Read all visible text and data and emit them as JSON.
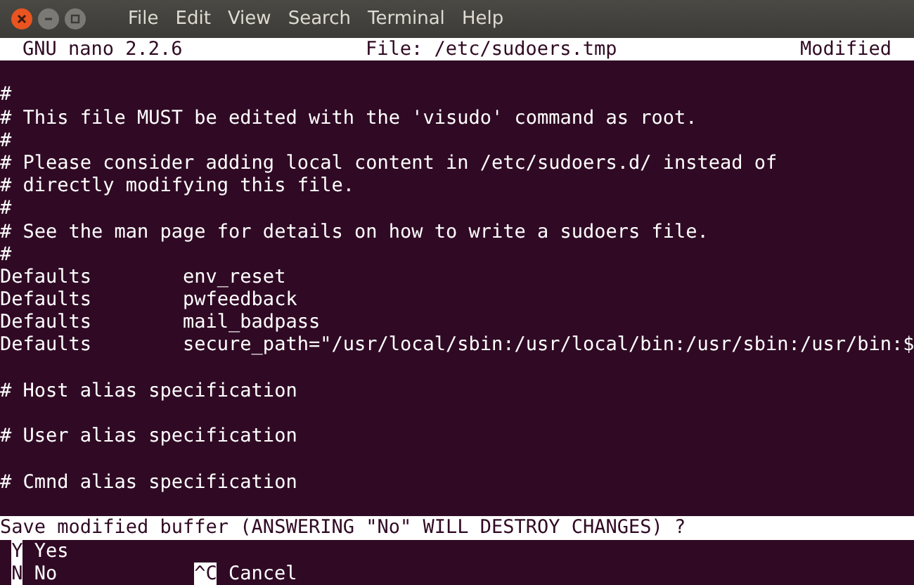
{
  "menu": [
    "File",
    "Edit",
    "View",
    "Search",
    "Terminal",
    "Help"
  ],
  "header": {
    "version": "GNU nano 2.2.6",
    "file": "File: /etc/sudoers.tmp",
    "status": "Modified"
  },
  "blocks": [
    [
      "#",
      "# This file MUST be edited with the 'visudo' command as root.",
      "#",
      "# Please consider adding local content in /etc/sudoers.d/ instead of",
      "# directly modifying this file.",
      "#",
      "# See the man page for details on how to write a sudoers file.",
      "#",
      "Defaults        env_reset",
      "Defaults        pwfeedback",
      "Defaults        mail_badpass",
      "Defaults        secure_path=\"/usr/local/sbin:/usr/local/bin:/usr/sbin:/usr/bin:$"
    ],
    [
      "# Host alias specification"
    ],
    [
      "# User alias specification"
    ],
    [
      "# Cmnd alias specification"
    ]
  ],
  "prompt": "Save modified buffer (ANSWERING \"No\" WILL DESTROY CHANGES) ?",
  "options": [
    [
      {
        "key": "Y",
        "label": "Yes"
      }
    ],
    [
      {
        "key": "N",
        "label": "No"
      },
      {
        "key": "^C",
        "label": "Cancel"
      }
    ]
  ]
}
